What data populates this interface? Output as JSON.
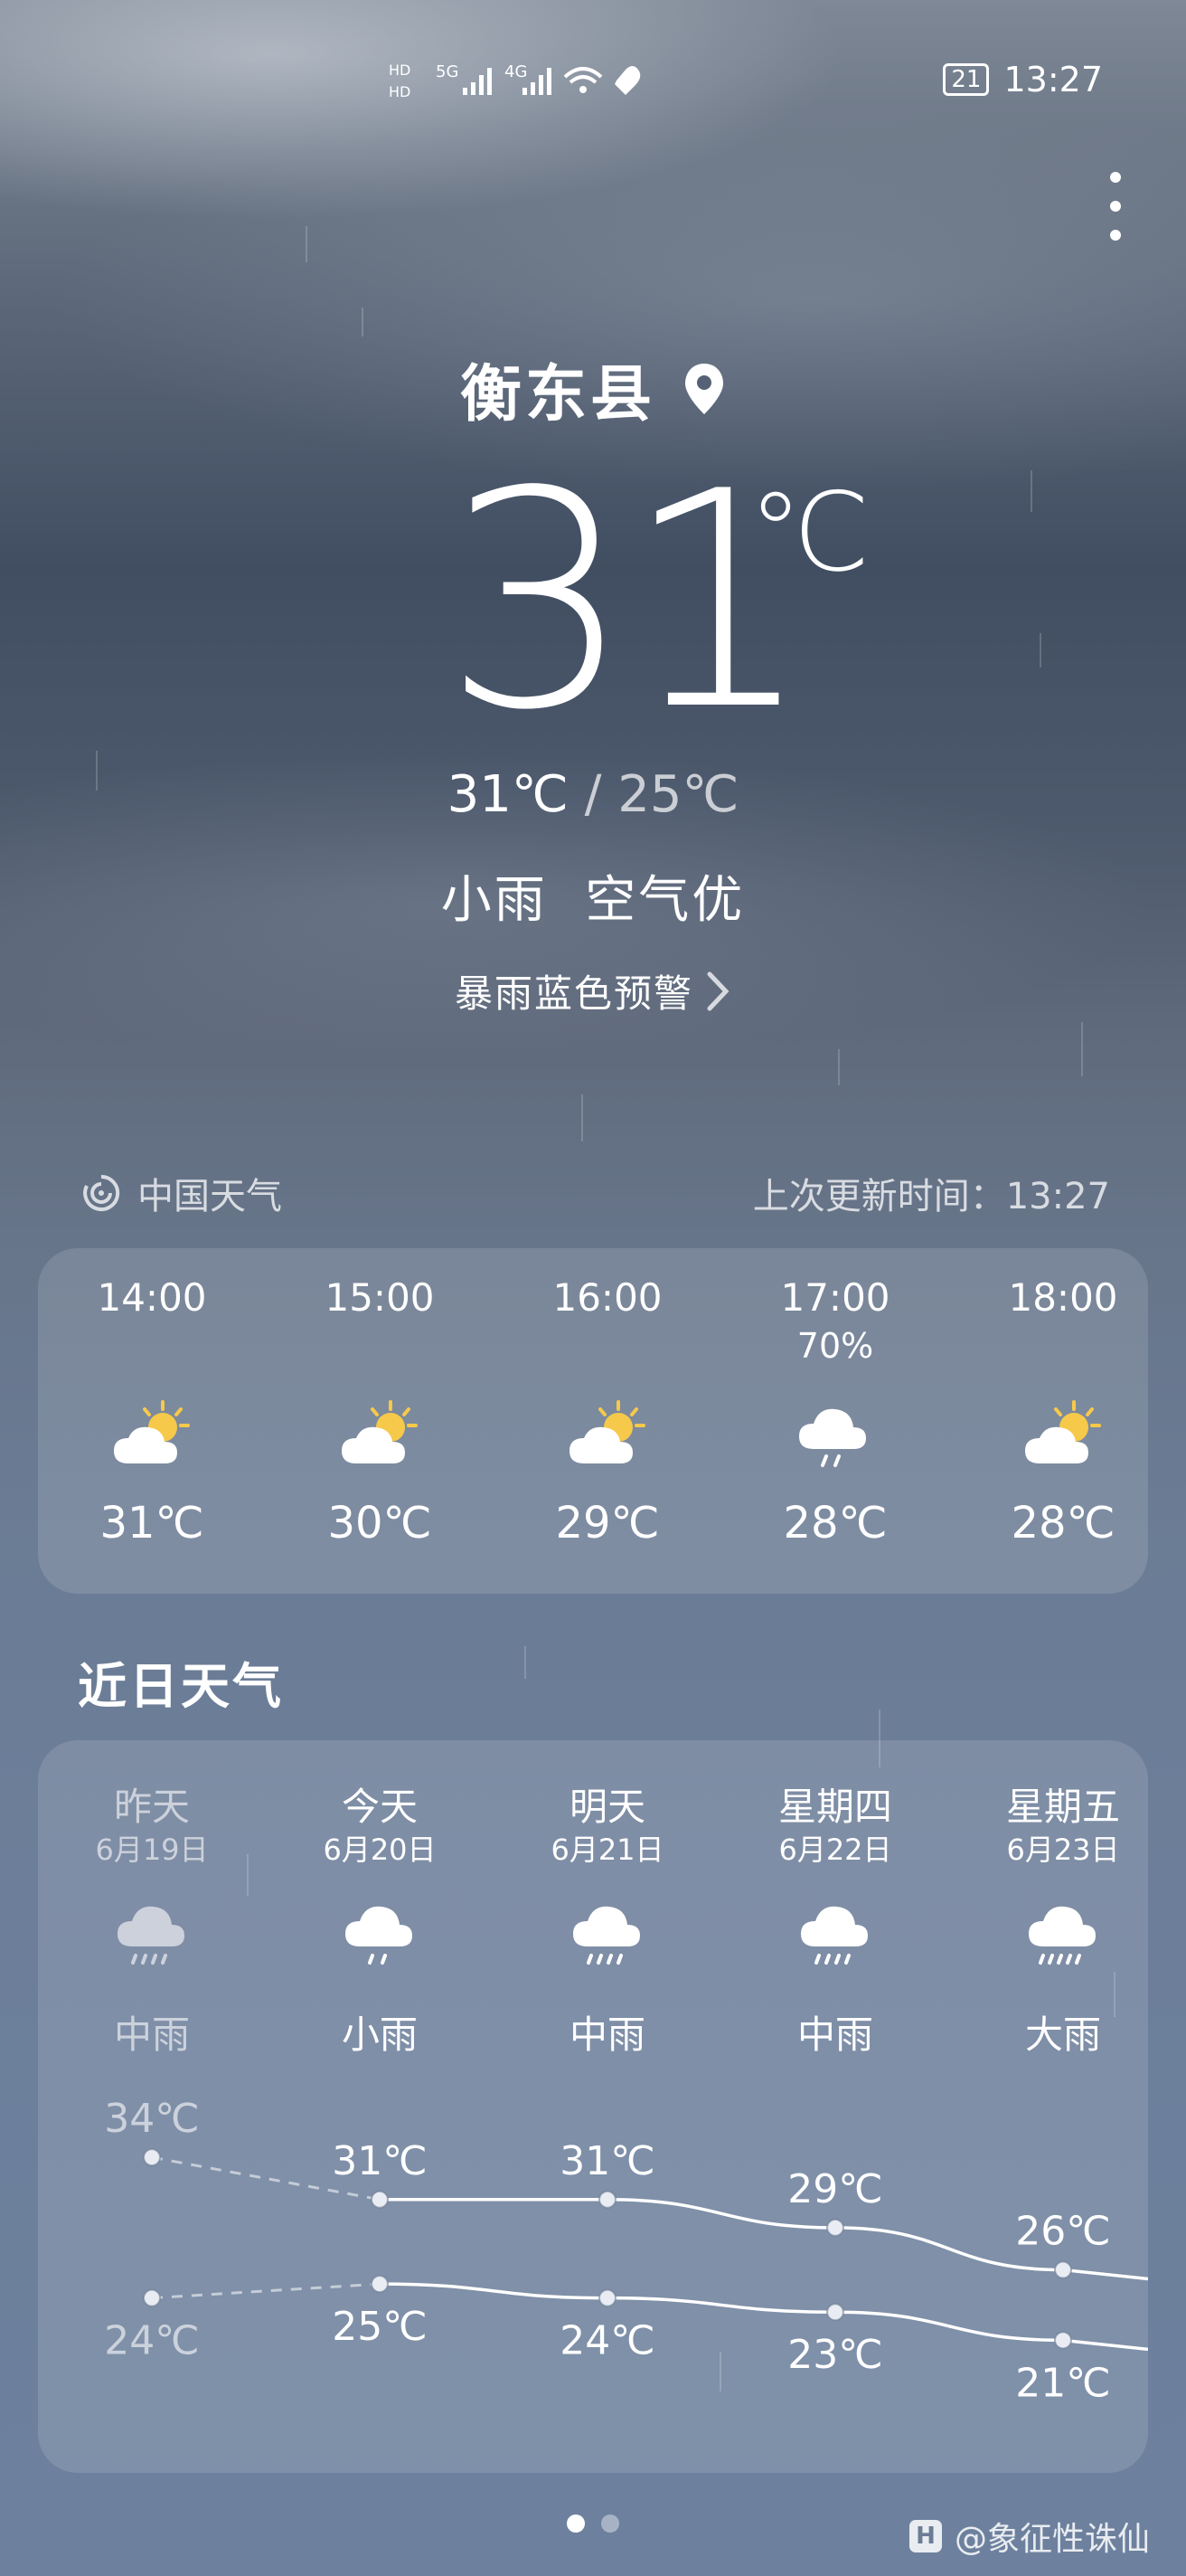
{
  "status_bar": {
    "time": "13:27",
    "battery": "21",
    "net1": "5G",
    "net2": "4G"
  },
  "location": {
    "city": "衡东县"
  },
  "current": {
    "temp": "31",
    "unit": "℃",
    "high": "31℃",
    "low": "25℃",
    "condition": "小雨",
    "air": "空气优",
    "warning": "暴雨蓝色预警"
  },
  "source": {
    "name": "中国天气",
    "update": "上次更新时间：13:27"
  },
  "hourly": [
    {
      "time": "14:00",
      "prob": "",
      "icon": "partly-cloudy-sun-icon",
      "temp": "31℃"
    },
    {
      "time": "15:00",
      "prob": "",
      "icon": "partly-cloudy-sun-icon",
      "temp": "30℃"
    },
    {
      "time": "16:00",
      "prob": "",
      "icon": "partly-cloudy-sun-icon",
      "temp": "29℃"
    },
    {
      "time": "17:00",
      "prob": "70%",
      "icon": "rain-cloud-icon",
      "temp": "28℃"
    },
    {
      "time": "18:00",
      "prob": "",
      "icon": "partly-cloudy-sun-icon",
      "temp": "28℃"
    }
  ],
  "daily_title": "近日天气",
  "daily": [
    {
      "day": "昨天",
      "date": "6月19日",
      "icon": "moderate-rain-icon",
      "cond": "中雨",
      "high": "34℃",
      "low": "24℃",
      "high_v": 34,
      "low_v": 24
    },
    {
      "day": "今天",
      "date": "6月20日",
      "icon": "light-rain-icon",
      "cond": "小雨",
      "high": "31℃",
      "low": "25℃",
      "high_v": 31,
      "low_v": 25
    },
    {
      "day": "明天",
      "date": "6月21日",
      "icon": "moderate-rain-icon",
      "cond": "中雨",
      "high": "31℃",
      "low": "24℃",
      "high_v": 31,
      "low_v": 24
    },
    {
      "day": "星期四",
      "date": "6月22日",
      "icon": "moderate-rain-icon",
      "cond": "中雨",
      "high": "29℃",
      "low": "23℃",
      "high_v": 29,
      "low_v": 23
    },
    {
      "day": "星期五",
      "date": "6月23日",
      "icon": "heavy-rain-icon",
      "cond": "大雨",
      "high": "26℃",
      "low": "21℃",
      "high_v": 26,
      "low_v": 21
    }
  ],
  "watermark": "@象征性诛仙",
  "watermark_logo": "H",
  "colors": {
    "line": "#ffffff",
    "dot": "#e9edf3"
  }
}
